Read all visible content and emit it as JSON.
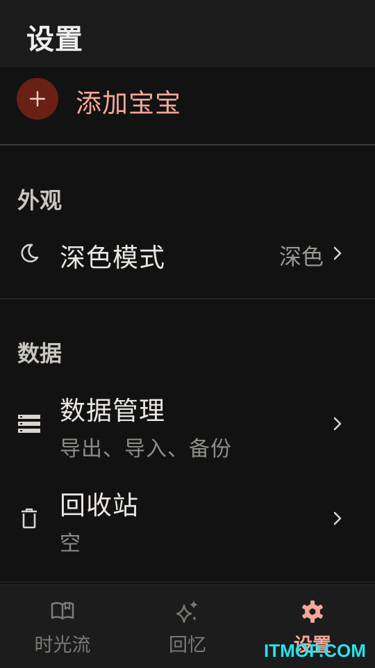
{
  "header": {
    "title": "设置"
  },
  "add_baby": {
    "label": "添加宝宝"
  },
  "appearance": {
    "section_title": "外观",
    "dark_mode": {
      "label": "深色模式",
      "value": "深色",
      "icon": "moon-icon"
    }
  },
  "data": {
    "section_title": "数据",
    "management": {
      "label": "数据管理",
      "subtitle": "导出、导入、备份",
      "icon": "database-icon"
    },
    "trash": {
      "label": "回收站",
      "subtitle": "空",
      "icon": "trash-icon"
    }
  },
  "bottom_nav": {
    "items": [
      {
        "label": "时光流",
        "icon": "open-book-icon",
        "active": false
      },
      {
        "label": "回忆",
        "icon": "sparkles-icon",
        "active": false
      },
      {
        "label": "设置",
        "icon": "gear-icon",
        "active": true
      }
    ]
  },
  "watermark": "ITMOP.COM",
  "colors": {
    "background": "#121212",
    "accent": "#f5a798",
    "accent_dark": "#6a2015",
    "watermark": "#26e2ec"
  }
}
